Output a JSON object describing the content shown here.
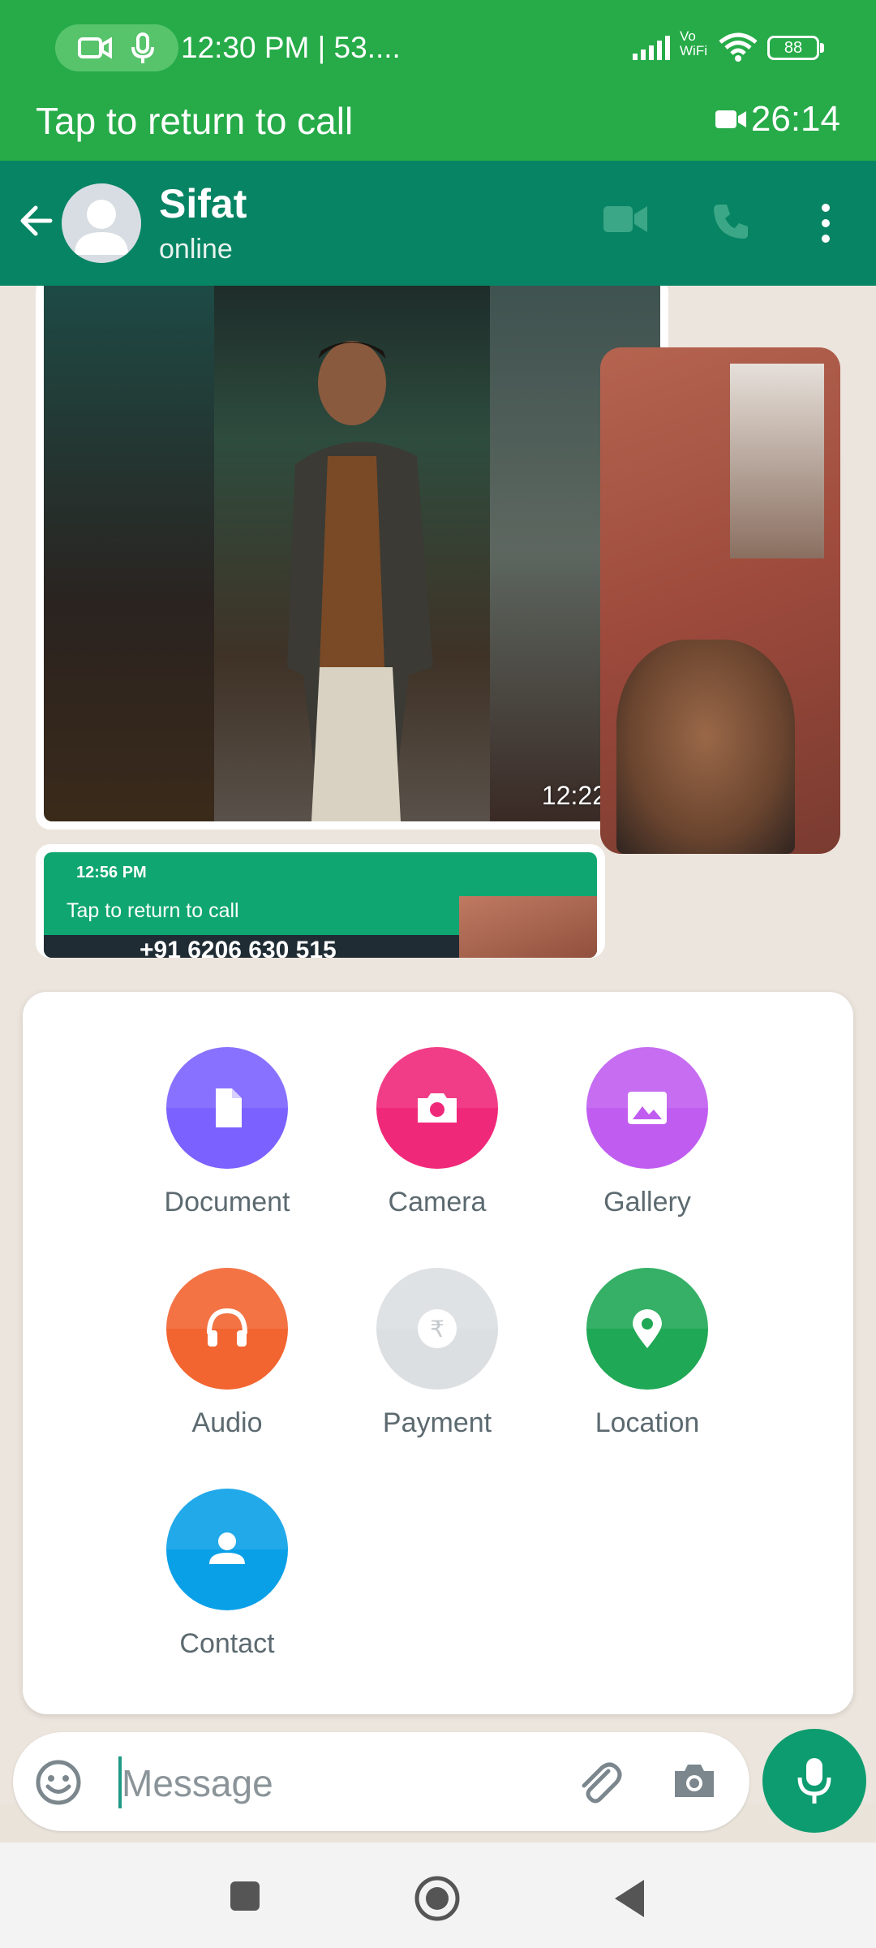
{
  "status_bar": {
    "time": "12:30 PM | 53....",
    "battery": "88",
    "network_label": "Vo WiFi"
  },
  "call_banner": {
    "text": "Tap to return to call",
    "timer": "26:14"
  },
  "chat_header": {
    "name": "Sifat",
    "status": "online"
  },
  "messages": {
    "photo_time": "12:22",
    "screenshot": {
      "time": "12:56 PM",
      "banner": "Tap to return to call",
      "number": "+91 6206 630 515"
    }
  },
  "attachments": [
    {
      "label": "Document",
      "color": "#7b61ff"
    },
    {
      "label": "Camera",
      "color": "#f0287a"
    },
    {
      "label": "Gallery",
      "color": "#c05df0"
    },
    {
      "label": "Audio",
      "color": "#f26430"
    },
    {
      "label": "Payment",
      "color": "#dcdfe2"
    },
    {
      "label": "Location",
      "color": "#1fa855"
    },
    {
      "label": "Contact",
      "color": "#0aa0e8"
    }
  ],
  "input": {
    "placeholder": "Message"
  },
  "colors": {
    "status_green": "#26ab48",
    "header_teal": "#078463",
    "mic_green": "#0c9c6f"
  }
}
